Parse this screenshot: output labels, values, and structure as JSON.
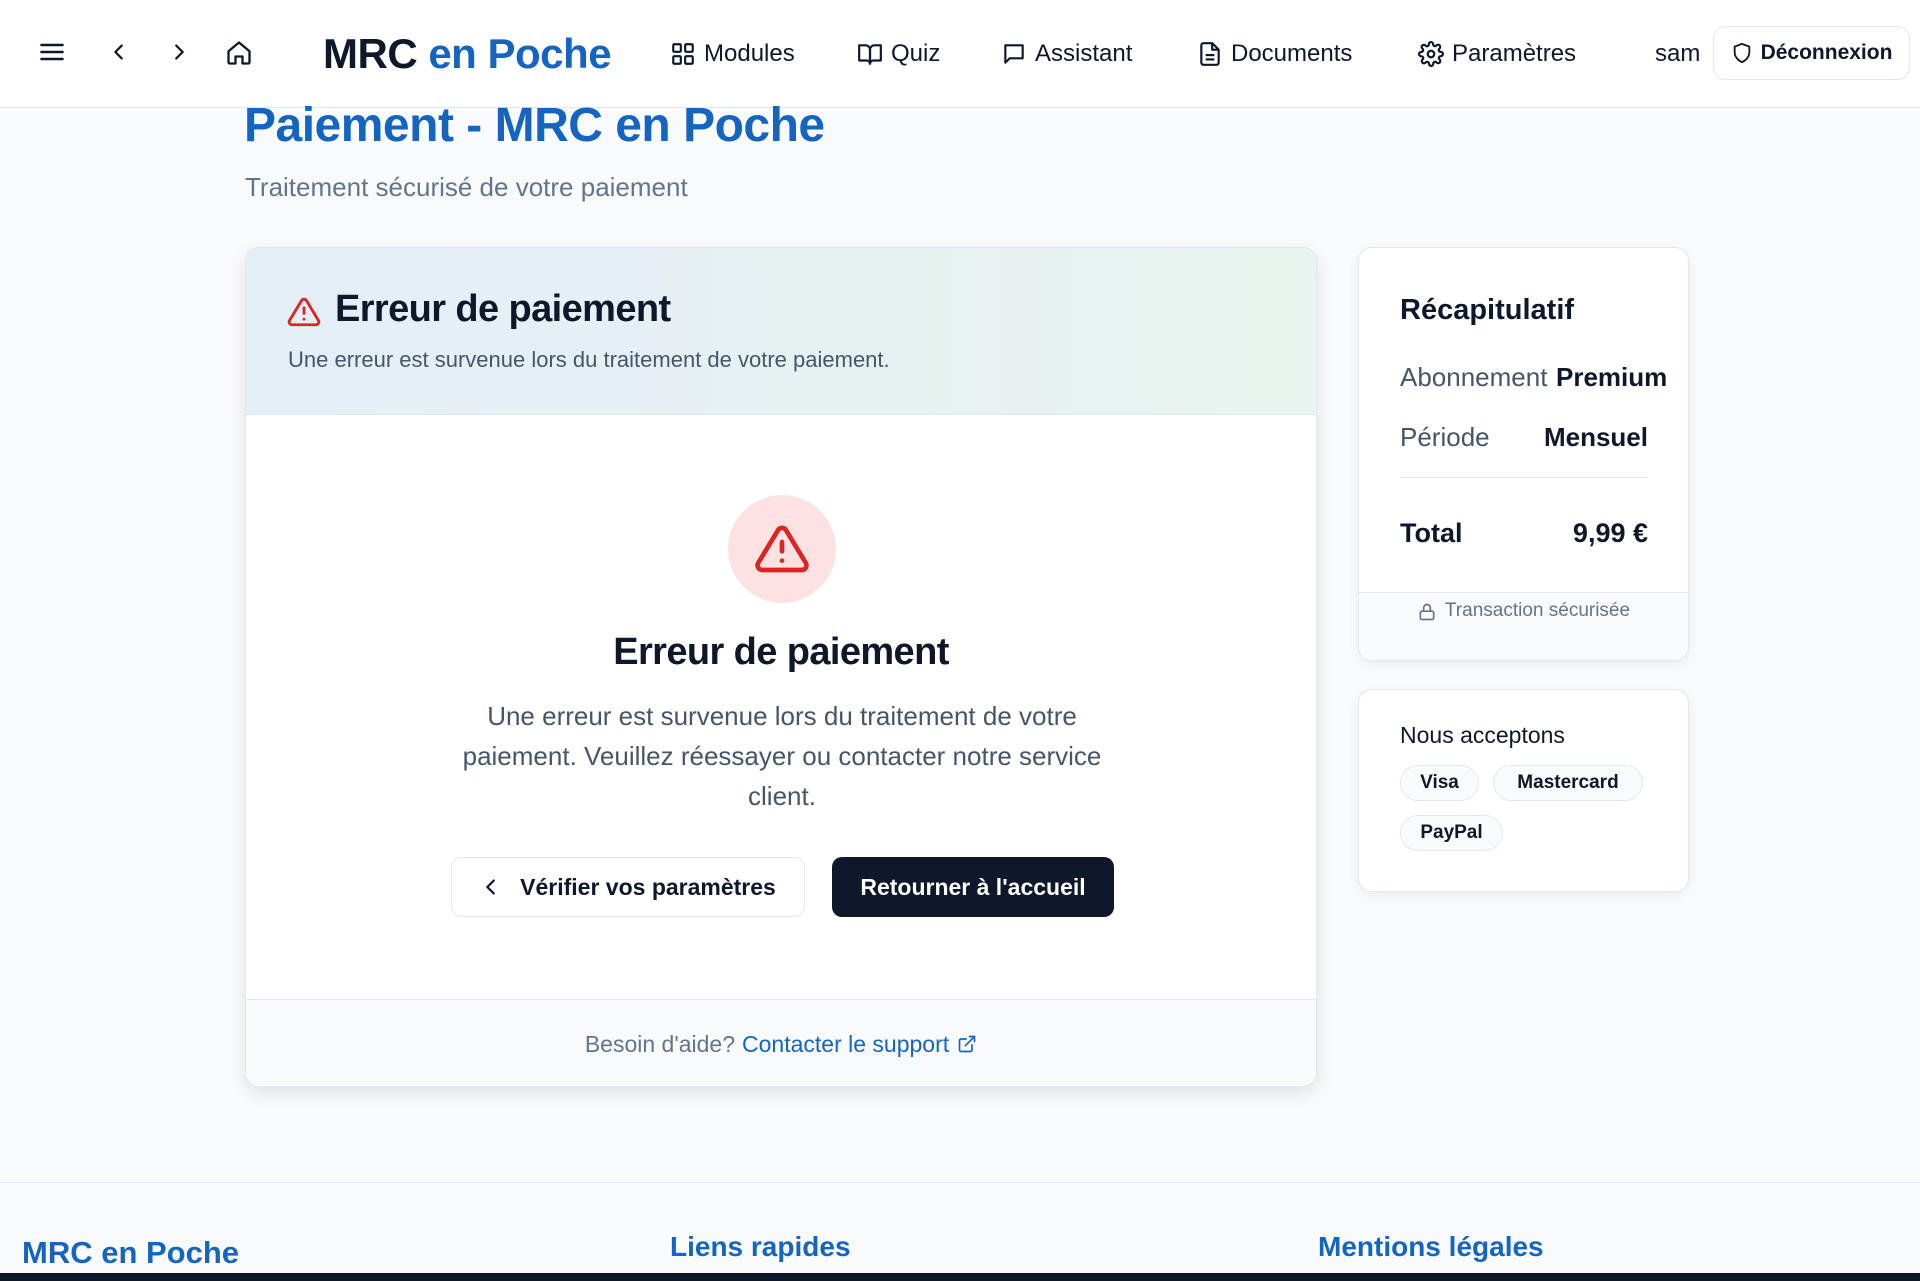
{
  "topbar": {
    "brand_part1": "MRC",
    "brand_part2": "en Poche",
    "nav": {
      "modules": "Modules",
      "quiz": "Quiz",
      "assistant": "Assistant",
      "documents": "Documents",
      "settings": "Paramètres"
    },
    "username": "sam",
    "logout_label": "Déconnexion"
  },
  "page": {
    "title": "Paiement - MRC en Poche",
    "subtitle": "Traitement sécurisé de votre paiement"
  },
  "error_card": {
    "header_title": "Erreur de paiement",
    "header_desc": "Une erreur est survenue lors du traitement de votre paiement.",
    "title": "Erreur de paiement",
    "message": "Une erreur est survenue lors du traitement de votre paiement. Veuillez réessayer ou contacter notre service client.",
    "check_settings_label": "Vérifier vos paramètres",
    "return_home_label": "Retourner à l'accueil",
    "help_text": "Besoin d'aide?",
    "support_link": "Contacter le support"
  },
  "summary": {
    "title": "Récapitulatif",
    "subscription_label": "Abonnement",
    "subscription_value": "Premium",
    "period_label": "Période",
    "period_value": "Mensuel",
    "total_label": "Total",
    "total_value": "9,99 €",
    "secure_label": "Transaction sécurisée"
  },
  "accepted": {
    "title": "Nous acceptons",
    "methods": [
      "Visa",
      "Mastercard",
      "PayPal"
    ]
  },
  "footer": {
    "brand": "MRC en Poche",
    "quick_links": "Liens rapides",
    "legal": "Mentions légales"
  },
  "colors": {
    "brand_blue": "#1565c0",
    "dark": "#0f172a",
    "error_red": "#dc2626",
    "error_bg": "#fde2e2"
  }
}
